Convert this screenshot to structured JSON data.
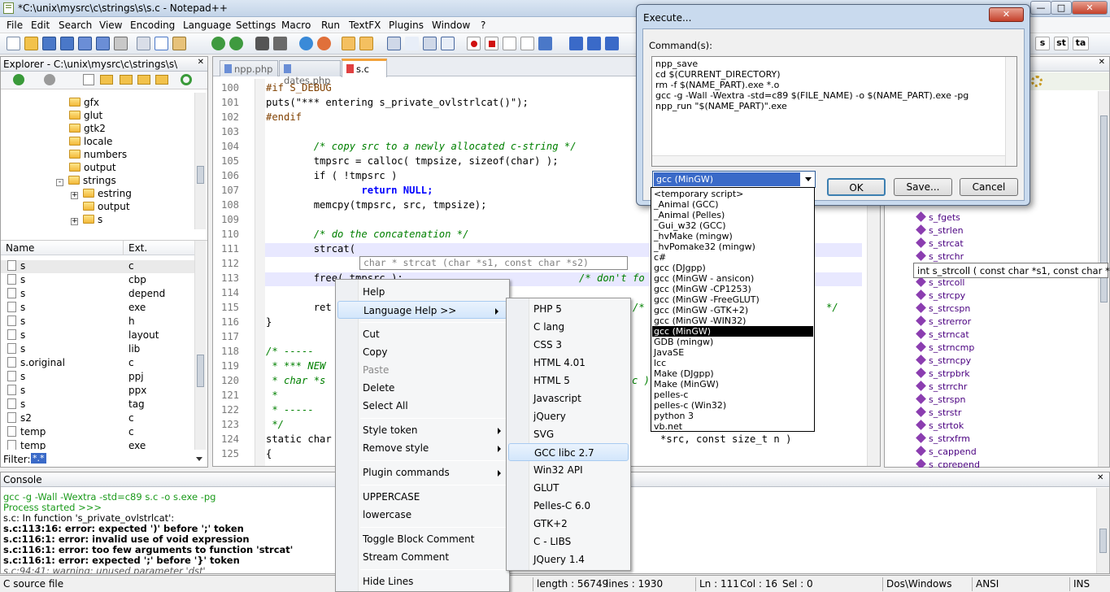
{
  "window": {
    "title": "*C:\\unix\\mysrc\\c\\strings\\s\\s.c - Notepad++",
    "min": "—",
    "max": "□",
    "close": "✕"
  },
  "menu": [
    "File",
    "Edit",
    "Search",
    "View",
    "Encoding",
    "Language",
    "Settings",
    "Macro",
    "Run",
    "TextFX",
    "Plugins",
    "Window",
    "?"
  ],
  "right_toolbar": [
    "s",
    "st",
    "ta"
  ],
  "explorer": {
    "title": "Explorer - C:\\unix\\mysrc\\c\\strings\\s\\",
    "close": "✕",
    "tree": [
      {
        "label": "gfx",
        "indent": 0
      },
      {
        "label": "glut",
        "indent": 0
      },
      {
        "label": "gtk2",
        "indent": 0
      },
      {
        "label": "locale",
        "indent": 0
      },
      {
        "label": "numbers",
        "indent": 0
      },
      {
        "label": "output",
        "indent": 0
      },
      {
        "label": "strings",
        "indent": 0
      },
      {
        "label": "estring",
        "indent": 1
      },
      {
        "label": "output",
        "indent": 1
      },
      {
        "label": "s",
        "indent": 1
      }
    ],
    "columns": [
      "Name",
      "Ext."
    ],
    "files": [
      {
        "name": "s",
        "ext": "c"
      },
      {
        "name": "s",
        "ext": "cbp"
      },
      {
        "name": "s",
        "ext": "depend"
      },
      {
        "name": "s",
        "ext": "exe"
      },
      {
        "name": "s",
        "ext": "h"
      },
      {
        "name": "s",
        "ext": "layout"
      },
      {
        "name": "s",
        "ext": "lib"
      },
      {
        "name": "s.original",
        "ext": "c"
      },
      {
        "name": "s",
        "ext": "ppj"
      },
      {
        "name": "s",
        "ext": "ppx"
      },
      {
        "name": "s",
        "ext": "tag"
      },
      {
        "name": "s2",
        "ext": "c"
      },
      {
        "name": "temp",
        "ext": "c"
      },
      {
        "name": "temp",
        "ext": "exe"
      }
    ],
    "filter_label": "Filter:",
    "filter_value": "*.*"
  },
  "tabs": [
    {
      "label": "npp.php",
      "active": false
    },
    {
      "label": "dates.php",
      "active": false
    },
    {
      "label": "s.c",
      "active": true
    }
  ],
  "editor": {
    "line_numbers": [
      "100",
      "101",
      "102",
      "103",
      "104",
      "105",
      "106",
      "107",
      "108",
      "109",
      "110",
      "111",
      "112",
      "113",
      "114",
      "115",
      "116",
      "117",
      "118",
      "119",
      "120",
      "121",
      "122",
      "123",
      "124",
      "125"
    ],
    "lines": [
      "#if S_DEBUG",
      "puts(\"*** entering s_private_ovlstrlcat()\");",
      "#endif",
      "",
      "        /* copy src to a newly allocated c-string */",
      "        tmpsrc = calloc( tmpsize, sizeof(char) );",
      "        if ( !tmpsrc )",
      "                return NULL;",
      "        memcpy(tmpsrc, src, tmpsize);",
      "",
      "        /* do the concatenation */",
      "        strcat(",
      "",
      "        free( tmpsrc );",
      "",
      "        ret",
      "}",
      "",
      "/* -----",
      " * *** NEW",
      " * char *s",
      " *",
      " * -----",
      " */",
      "static char",
      "{"
    ],
    "calltip": "char * strcat (char *s1, const char *s2)",
    "line113_tail": "/* don't fo",
    "line115_tail": "/*",
    "line115_end": "*/",
    "line124_tail": "*src, const size_t n )",
    "line120_tail": "c )"
  },
  "context_menu": {
    "items": [
      "Help",
      "Language Help >>",
      "Cut",
      "Copy",
      "Paste",
      "Delete",
      "Select All",
      "Style token",
      "Remove style",
      "Plugin commands",
      "UPPERCASE",
      "lowercase",
      "Toggle Block Comment",
      "Stream Comment",
      "Hide Lines"
    ]
  },
  "language_help_submenu": [
    "PHP 5",
    "C lang",
    "CSS 3",
    "HTML 4.01",
    "HTML 5",
    "Javascript",
    "jQuery",
    "SVG",
    "GCC libc 2.7",
    "Win32 API",
    "GLUT",
    "Pelles-C 6.0",
    "GTK+2",
    "C - LIBS",
    "JQuery 1.4"
  ],
  "execute_dialog": {
    "title": "Execute...",
    "close": "✕",
    "commands_label": "Command(s):",
    "commands": [
      "npp_save",
      "cd $(CURRENT_DIRECTORY)",
      "rm -f $(NAME_PART).exe *.o",
      "gcc -g -Wall -Wextra -std=c89 $(FILE_NAME) -o $(NAME_PART).exe -pg",
      "npp_run \"$(NAME_PART)\".exe"
    ],
    "script_selected": "gcc (MinGW)",
    "ok": "OK",
    "save": "Save...",
    "cancel": "Cancel",
    "scripts": [
      "<temporary script>",
      "_Animal (GCC)",
      "_Animal (Pelles)",
      "_Gui_w32 (GCC)",
      "_hvMake (mingw)",
      "_hvPomake32 (mingw)",
      "c#",
      "gcc (DJgpp)",
      "gcc (MinGW - ansicon)",
      "gcc (MinGW -CP1253)",
      "gcc (MinGW -FreeGLUT)",
      "gcc (MinGW -GTK+2)",
      "gcc (MinGW -WIN32)",
      "gcc (MinGW)",
      "GDB (mingw)",
      "JavaSE",
      "lcc",
      "Make (DJgpp)",
      "Make (MinGW)",
      "pelles-c",
      "pelles-c (Win32)",
      "python 3",
      "vb.net"
    ]
  },
  "function_list": {
    "items": [
      "s_fgets",
      "s_strlen",
      "s_strcat",
      "s_strchr",
      "s_strcmp",
      "s_strcoll",
      "s_strcpy",
      "s_strcspn",
      "s_strerror",
      "s_strncat",
      "s_strncmp",
      "s_strncpy",
      "s_strpbrk",
      "s_strrchr",
      "s_strspn",
      "s_strstr",
      "s_strtok",
      "s_strxfrm",
      "s_cappend",
      "s_cprepend"
    ],
    "tooltip": "int s_strcoll ( const char *s1, const char *s2 )"
  },
  "console": {
    "title": "Console",
    "close": "✕",
    "lines": [
      {
        "text": "gcc -g -Wall -Wextra -std=c89 s.c -o s.exe -pg",
        "style": "green"
      },
      {
        "text": "Process started >>>",
        "style": "green"
      },
      {
        "text": "s.c: In function 's_private_ovlstrlcat':",
        "style": "normal"
      },
      {
        "text": "s.c:113:16: error: expected ')' before ';' token",
        "style": "bold"
      },
      {
        "text": "s.c:116:1: error: invalid use of void expression",
        "style": "bold"
      },
      {
        "text": "s.c:116:1: error: too few arguments to function 'strcat'",
        "style": "bold"
      },
      {
        "text": "s.c:116:1: error: expected ';' before '}' token",
        "style": "bold"
      },
      {
        "text": "s.c:94:41: warning: unused parameter 'dst'",
        "style": "italic"
      }
    ]
  },
  "status": {
    "filetype": "C source file",
    "length": "length : 56749",
    "lines": "lines : 1930",
    "ln": "Ln : 111",
    "col": "Col : 16",
    "sel": "Sel : 0",
    "eol": "Dos\\Windows",
    "enc": "ANSI",
    "ins": "INS"
  },
  "colors": {
    "keyword": "#0000ff",
    "comment": "#008000",
    "preproc": "#804000",
    "highlight": "#e8e8ff",
    "selection": "#000000"
  }
}
